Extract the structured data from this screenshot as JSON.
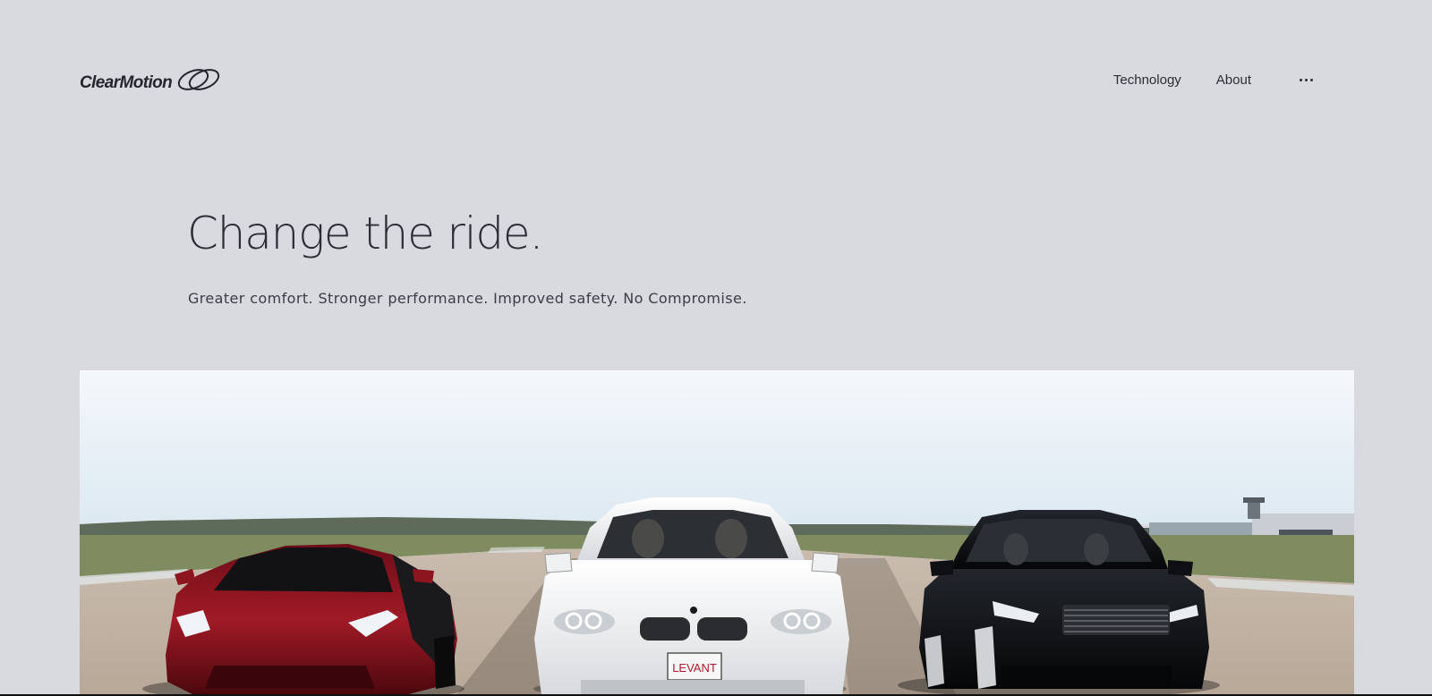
{
  "brand": {
    "name": "ClearMotion",
    "logo_icon": "double-ring-icon"
  },
  "nav": {
    "items": [
      {
        "label": "Technology"
      },
      {
        "label": "About"
      }
    ],
    "more_icon": "more-horizontal-icon"
  },
  "hero": {
    "headline": "Change the ride.",
    "tagline": "Greater comfort. Stronger performance. Improved safety. No Compromise.",
    "image": {
      "subject": "three-cars-on-runway",
      "license_plate": "LEVANT"
    }
  },
  "colors": {
    "background": "#d9dadf",
    "text": "#22252b",
    "sky": "#e8f2f8",
    "car_red": "#8c1520",
    "car_white": "#f2f3f5",
    "car_black": "#0d0f12"
  }
}
